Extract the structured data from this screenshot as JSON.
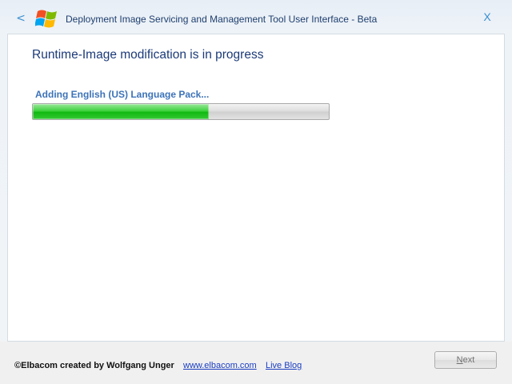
{
  "window": {
    "title": "Deployment Image Servicing and Management Tool User Interface   -  Beta",
    "back_glyph": "<",
    "close_glyph": "X",
    "logo_icon": "windows-flag-icon"
  },
  "main": {
    "heading": "Runtime-Image modification is in progress",
    "progress": {
      "label": "Adding English (US) Language Pack...",
      "value_fraction": 0.595,
      "fill_color": "#1cc21c"
    }
  },
  "footer": {
    "credit": "©Elbacom created by Wolfgang Unger",
    "links": [
      {
        "label": "www.elbacom.com"
      },
      {
        "label": "Live Blog"
      }
    ],
    "next_button": {
      "mnemonic": "N",
      "rest": "ext",
      "enabled": false
    }
  },
  "colors": {
    "accent": "#3a8fd0",
    "heading": "#1c3a78",
    "link": "#1a3dc2"
  }
}
